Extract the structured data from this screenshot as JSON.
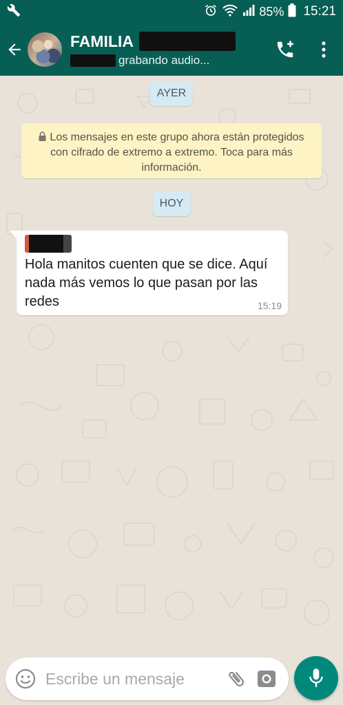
{
  "status_bar": {
    "battery_percent": "85%",
    "time": "15:21",
    "icons": [
      "wrench-icon",
      "alarm-icon",
      "wifi-icon",
      "signal-icon",
      "battery-icon"
    ]
  },
  "header": {
    "group_name": "FAMILIA",
    "subtitle": "grabando audio...",
    "actions": [
      "add-call-icon",
      "more-vert-icon"
    ]
  },
  "chat": {
    "date_yesterday": "AYER",
    "encryption_notice": "Los mensajes en este grupo ahora están protegidos con cifrado de extremo a extremo. Toca para más información.",
    "date_today": "HOY",
    "messages": [
      {
        "text": "Hola manitos cuenten que se dice. Aquí nada más vemos lo que pasan por las redes",
        "time": "15:19"
      }
    ]
  },
  "composer": {
    "placeholder": "Escribe un mensaje",
    "icons": [
      "emoji-icon",
      "attach-icon",
      "camera-icon",
      "mic-icon"
    ]
  },
  "colors": {
    "header": "#075e54",
    "accent": "#00897b",
    "notice_bg": "#fdf3c4",
    "date_pill_bg": "#d6eaf4",
    "chat_bg": "#e8e2d9"
  }
}
